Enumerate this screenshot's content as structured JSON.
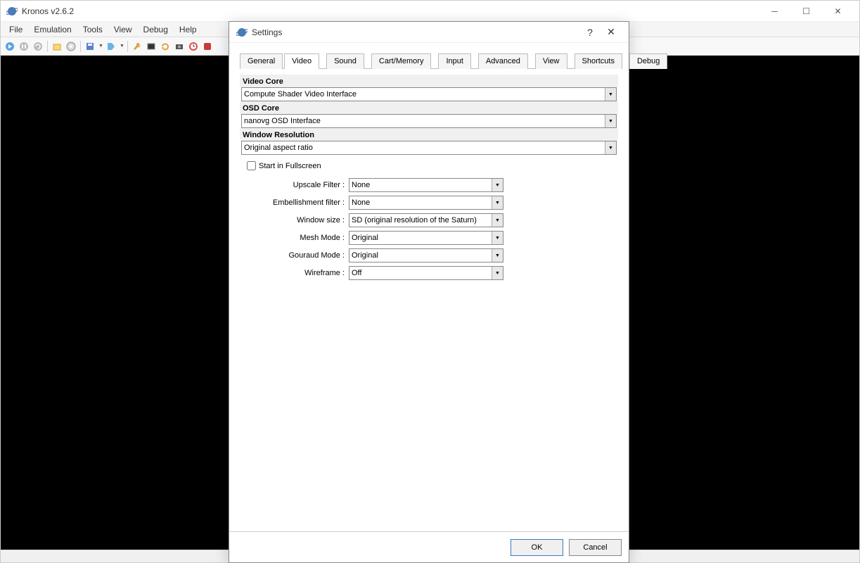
{
  "window": {
    "title": "Kronos v2.6.2"
  },
  "menubar": [
    "File",
    "Emulation",
    "Tools",
    "View",
    "Debug",
    "Help"
  ],
  "dialog": {
    "title": "Settings",
    "help_char": "?",
    "close_char": "✕",
    "tabs": [
      "General",
      "Video",
      "Sound",
      "Cart/Memory",
      "Input",
      "Advanced",
      "View",
      "Shortcuts",
      "Debug"
    ],
    "active_tab": "Video",
    "sections": {
      "video_core": {
        "label": "Video Core",
        "value": "Compute Shader Video Interface"
      },
      "osd_core": {
        "label": "OSD Core",
        "value": "nanovg OSD Interface"
      },
      "window_resolution": {
        "label": "Window Resolution",
        "value": "Original aspect ratio"
      }
    },
    "fullscreen": {
      "label": "Start in Fullscreen",
      "checked": false
    },
    "options": {
      "upscale_filter": {
        "label": "Upscale Filter :",
        "value": "None"
      },
      "embellishment_filter": {
        "label": "Embellishment filter :",
        "value": "None"
      },
      "window_size": {
        "label": "Window size :",
        "value": "SD (original resolution of the Saturn)"
      },
      "mesh_mode": {
        "label": "Mesh Mode :",
        "value": "Original"
      },
      "gouraud_mode": {
        "label": "Gouraud Mode :",
        "value": "Original"
      },
      "wireframe": {
        "label": "Wireframe :",
        "value": "Off"
      }
    },
    "buttons": {
      "ok": "OK",
      "cancel": "Cancel"
    }
  }
}
